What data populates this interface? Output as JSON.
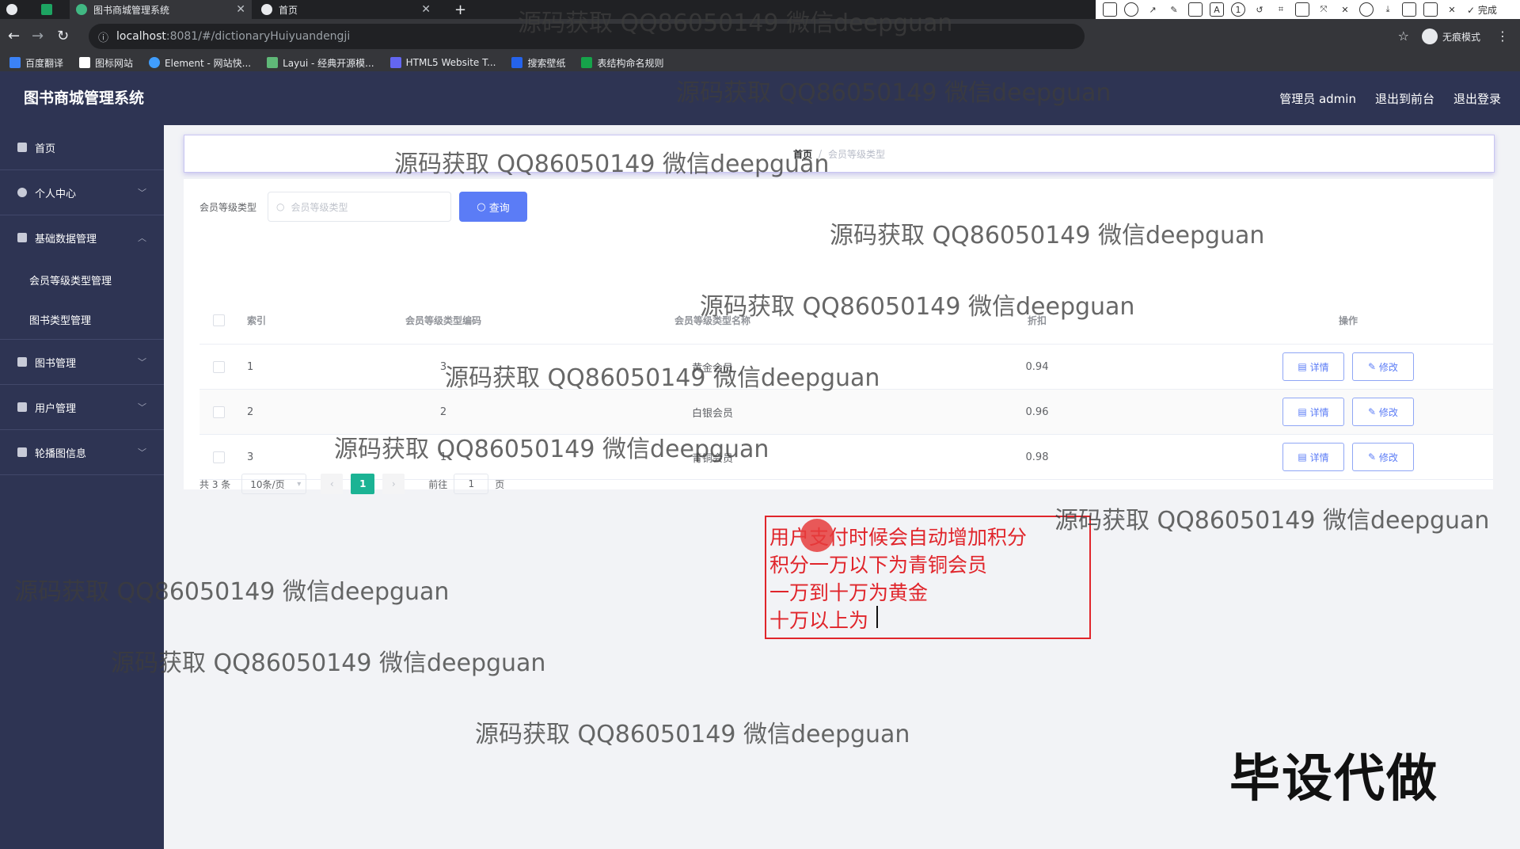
{
  "browser": {
    "tabs": [
      {
        "title": "图书商城管理系统",
        "active": true
      },
      {
        "title": "首页",
        "active": false
      }
    ],
    "url_host": "localhost",
    "url_path": ":8081/#/dictionaryHuiyuandengji",
    "bookmarks": [
      "百度翻译",
      "图标网站",
      "Element - 网站快...",
      "Layui - 经典开源模...",
      "HTML5 Website T...",
      "搜索壁纸",
      "表结构命名规则"
    ],
    "profile_label": "无痕模式"
  },
  "annotation_tool": {
    "font_size": "20",
    "done_label": "完成",
    "current_color": "#f04040"
  },
  "app": {
    "title": "图书商城管理系统",
    "topnav": {
      "admin": "管理员 admin",
      "back_front": "退出到前台",
      "logout": "退出登录"
    },
    "sidebar": {
      "items": [
        {
          "label": "首页"
        },
        {
          "label": "个人中心"
        },
        {
          "label": "基础数据管理"
        },
        {
          "label": "图书管理"
        },
        {
          "label": "用户管理"
        },
        {
          "label": "轮播图信息"
        }
      ],
      "subitems": [
        "会员等级类型管理",
        "图书类型管理"
      ]
    },
    "breadcrumb": {
      "home": "首页",
      "current": "会员等级类型"
    },
    "search": {
      "label": "会员等级类型",
      "placeholder": "会员等级类型",
      "button": "查询"
    },
    "table": {
      "headers": [
        "索引",
        "会员等级类型编码",
        "会员等级类型名称",
        "折扣",
        "操作"
      ],
      "rows": [
        {
          "index": "1",
          "code": "3",
          "name": "黄金会员",
          "discount": "0.94"
        },
        {
          "index": "2",
          "code": "2",
          "name": "白银会员",
          "discount": "0.96"
        },
        {
          "index": "3",
          "code": "1",
          "name": "青铜会员",
          "discount": "0.98"
        }
      ],
      "detail_label": "详情",
      "edit_label": "修改"
    },
    "pagination": {
      "total": "共 3 条",
      "page_size": "10条/页",
      "current_page": "1",
      "goto_label": "前往",
      "goto_value": "1",
      "page_suffix": "页"
    }
  },
  "overlay": {
    "note_lines": [
      "用户支付时候会自动增加积分",
      "积分一万以下为青铜会员",
      "一万到十万为黄金",
      "十万以上为"
    ],
    "watermark": "源码获取 QQ86050149 微信deepguan",
    "big_text": "毕设代做"
  }
}
